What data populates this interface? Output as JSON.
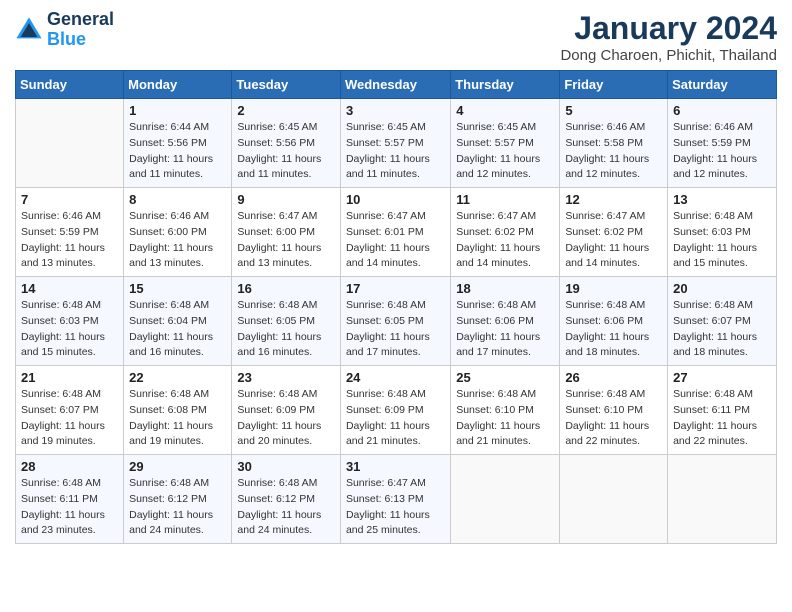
{
  "logo": {
    "line1": "General",
    "line2": "Blue"
  },
  "title": "January 2024",
  "subtitle": "Dong Charoen, Phichit, Thailand",
  "days_of_week": [
    "Sunday",
    "Monday",
    "Tuesday",
    "Wednesday",
    "Thursday",
    "Friday",
    "Saturday"
  ],
  "weeks": [
    [
      {
        "day": "",
        "info": ""
      },
      {
        "day": "1",
        "info": "Sunrise: 6:44 AM\nSunset: 5:56 PM\nDaylight: 11 hours\nand 11 minutes."
      },
      {
        "day": "2",
        "info": "Sunrise: 6:45 AM\nSunset: 5:56 PM\nDaylight: 11 hours\nand 11 minutes."
      },
      {
        "day": "3",
        "info": "Sunrise: 6:45 AM\nSunset: 5:57 PM\nDaylight: 11 hours\nand 11 minutes."
      },
      {
        "day": "4",
        "info": "Sunrise: 6:45 AM\nSunset: 5:57 PM\nDaylight: 11 hours\nand 12 minutes."
      },
      {
        "day": "5",
        "info": "Sunrise: 6:46 AM\nSunset: 5:58 PM\nDaylight: 11 hours\nand 12 minutes."
      },
      {
        "day": "6",
        "info": "Sunrise: 6:46 AM\nSunset: 5:59 PM\nDaylight: 11 hours\nand 12 minutes."
      }
    ],
    [
      {
        "day": "7",
        "info": "Sunrise: 6:46 AM\nSunset: 5:59 PM\nDaylight: 11 hours\nand 13 minutes."
      },
      {
        "day": "8",
        "info": "Sunrise: 6:46 AM\nSunset: 6:00 PM\nDaylight: 11 hours\nand 13 minutes."
      },
      {
        "day": "9",
        "info": "Sunrise: 6:47 AM\nSunset: 6:00 PM\nDaylight: 11 hours\nand 13 minutes."
      },
      {
        "day": "10",
        "info": "Sunrise: 6:47 AM\nSunset: 6:01 PM\nDaylight: 11 hours\nand 14 minutes."
      },
      {
        "day": "11",
        "info": "Sunrise: 6:47 AM\nSunset: 6:02 PM\nDaylight: 11 hours\nand 14 minutes."
      },
      {
        "day": "12",
        "info": "Sunrise: 6:47 AM\nSunset: 6:02 PM\nDaylight: 11 hours\nand 14 minutes."
      },
      {
        "day": "13",
        "info": "Sunrise: 6:48 AM\nSunset: 6:03 PM\nDaylight: 11 hours\nand 15 minutes."
      }
    ],
    [
      {
        "day": "14",
        "info": "Sunrise: 6:48 AM\nSunset: 6:03 PM\nDaylight: 11 hours\nand 15 minutes."
      },
      {
        "day": "15",
        "info": "Sunrise: 6:48 AM\nSunset: 6:04 PM\nDaylight: 11 hours\nand 16 minutes."
      },
      {
        "day": "16",
        "info": "Sunrise: 6:48 AM\nSunset: 6:05 PM\nDaylight: 11 hours\nand 16 minutes."
      },
      {
        "day": "17",
        "info": "Sunrise: 6:48 AM\nSunset: 6:05 PM\nDaylight: 11 hours\nand 17 minutes."
      },
      {
        "day": "18",
        "info": "Sunrise: 6:48 AM\nSunset: 6:06 PM\nDaylight: 11 hours\nand 17 minutes."
      },
      {
        "day": "19",
        "info": "Sunrise: 6:48 AM\nSunset: 6:06 PM\nDaylight: 11 hours\nand 18 minutes."
      },
      {
        "day": "20",
        "info": "Sunrise: 6:48 AM\nSunset: 6:07 PM\nDaylight: 11 hours\nand 18 minutes."
      }
    ],
    [
      {
        "day": "21",
        "info": "Sunrise: 6:48 AM\nSunset: 6:07 PM\nDaylight: 11 hours\nand 19 minutes."
      },
      {
        "day": "22",
        "info": "Sunrise: 6:48 AM\nSunset: 6:08 PM\nDaylight: 11 hours\nand 19 minutes."
      },
      {
        "day": "23",
        "info": "Sunrise: 6:48 AM\nSunset: 6:09 PM\nDaylight: 11 hours\nand 20 minutes."
      },
      {
        "day": "24",
        "info": "Sunrise: 6:48 AM\nSunset: 6:09 PM\nDaylight: 11 hours\nand 21 minutes."
      },
      {
        "day": "25",
        "info": "Sunrise: 6:48 AM\nSunset: 6:10 PM\nDaylight: 11 hours\nand 21 minutes."
      },
      {
        "day": "26",
        "info": "Sunrise: 6:48 AM\nSunset: 6:10 PM\nDaylight: 11 hours\nand 22 minutes."
      },
      {
        "day": "27",
        "info": "Sunrise: 6:48 AM\nSunset: 6:11 PM\nDaylight: 11 hours\nand 22 minutes."
      }
    ],
    [
      {
        "day": "28",
        "info": "Sunrise: 6:48 AM\nSunset: 6:11 PM\nDaylight: 11 hours\nand 23 minutes."
      },
      {
        "day": "29",
        "info": "Sunrise: 6:48 AM\nSunset: 6:12 PM\nDaylight: 11 hours\nand 24 minutes."
      },
      {
        "day": "30",
        "info": "Sunrise: 6:48 AM\nSunset: 6:12 PM\nDaylight: 11 hours\nand 24 minutes."
      },
      {
        "day": "31",
        "info": "Sunrise: 6:47 AM\nSunset: 6:13 PM\nDaylight: 11 hours\nand 25 minutes."
      },
      {
        "day": "",
        "info": ""
      },
      {
        "day": "",
        "info": ""
      },
      {
        "day": "",
        "info": ""
      }
    ]
  ]
}
